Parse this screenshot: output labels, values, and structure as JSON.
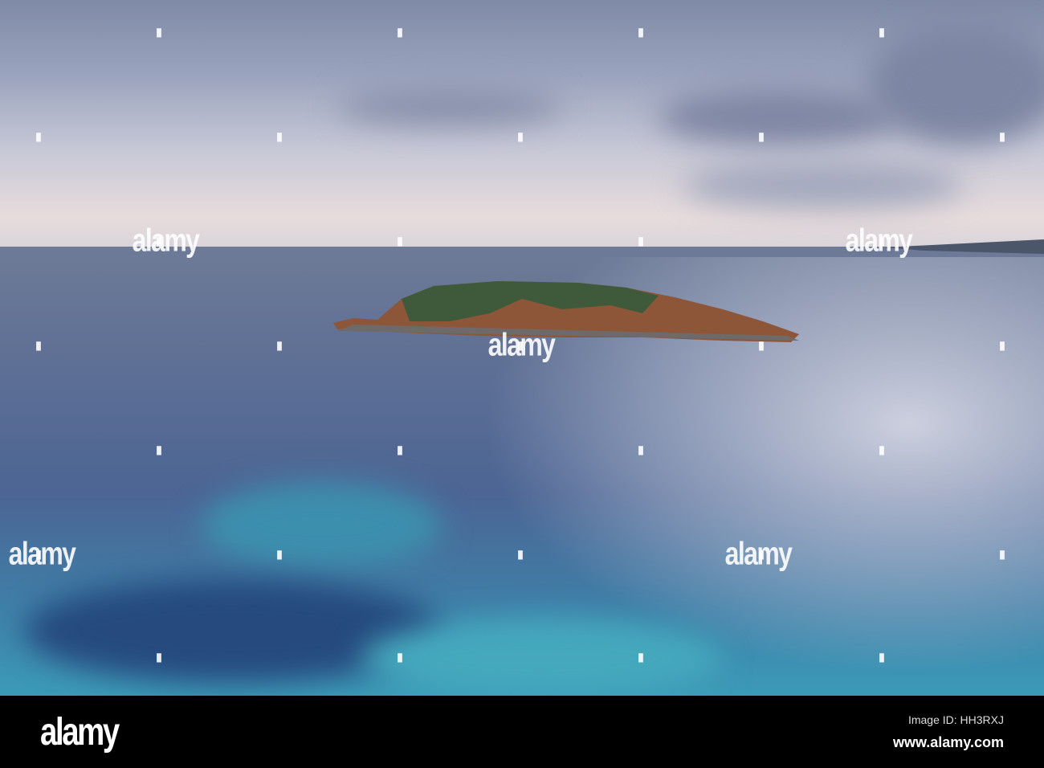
{
  "watermark": "alamy",
  "footer": {
    "logo": "alamy",
    "image_id": "Image ID: HH3RXJ",
    "website": "www.alamy.com"
  },
  "colors": {
    "sky_top": "#7f8aa6",
    "horizon": "#e7dcdc",
    "sea_deep": "#4c6594",
    "sea_turquoise": "#3b9bb8",
    "island_rock": "#9a5a3a",
    "island_green": "#3c5a3a"
  }
}
